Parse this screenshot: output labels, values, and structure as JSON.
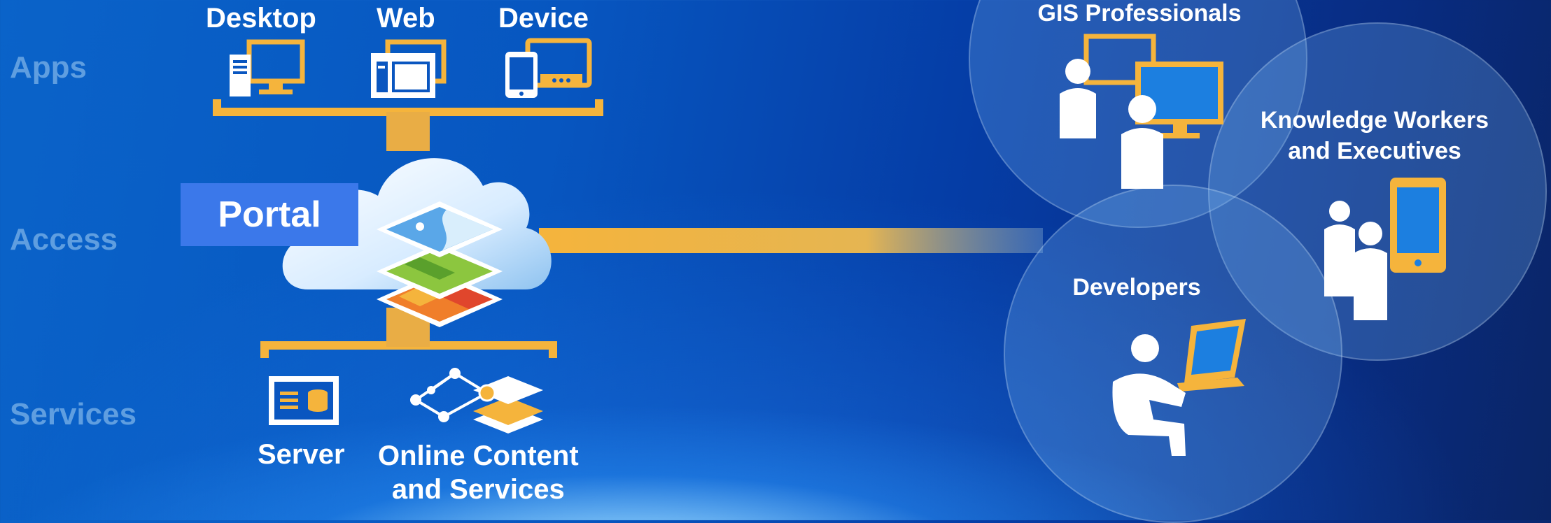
{
  "tiers": {
    "apps": "Apps",
    "access": "Access",
    "services": "Services"
  },
  "apps": {
    "desktop": "Desktop",
    "web": "Web",
    "device": "Device"
  },
  "portal": {
    "label": "Portal"
  },
  "services": {
    "server": "Server",
    "online_line1": "Online Content",
    "online_line2": "and Services"
  },
  "users": {
    "gis": "GIS Professionals",
    "knowledge_line1": "Knowledge Workers",
    "knowledge_line2": "and Executives",
    "developers": "Developers"
  },
  "colors": {
    "accent": "#f5b43c",
    "portal_blue": "#3b78ea",
    "tier_label": "#5f9ee0"
  }
}
